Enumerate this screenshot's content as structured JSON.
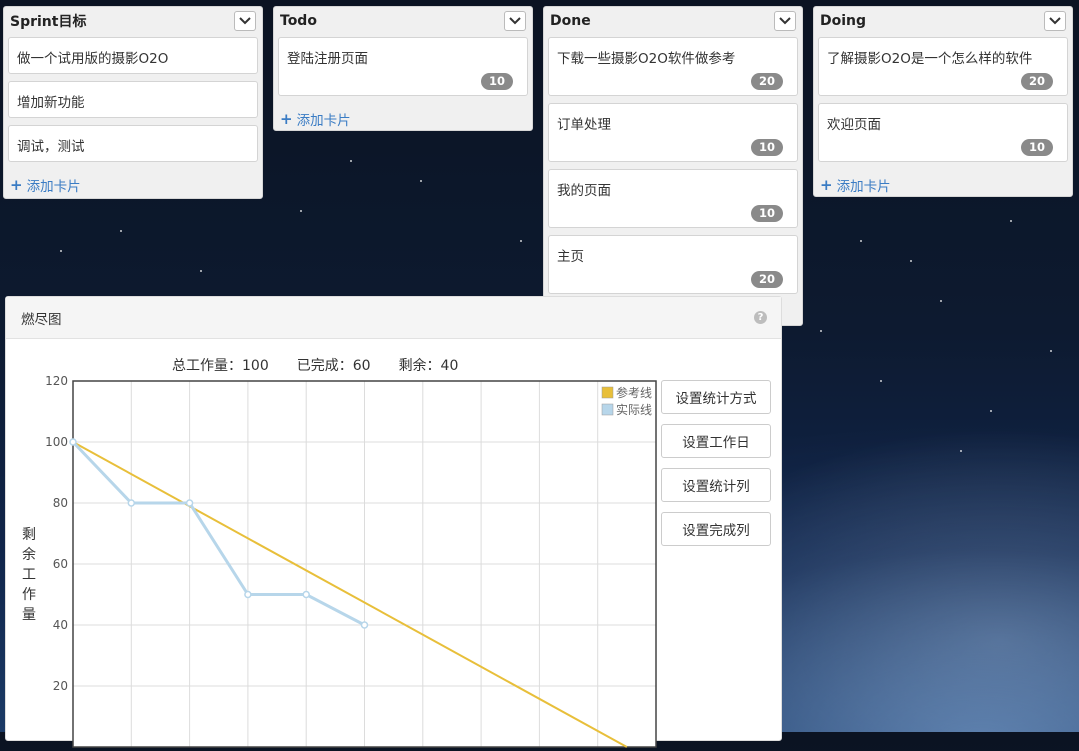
{
  "board": {
    "lists": [
      {
        "title": "Sprint目标",
        "cards": [
          {
            "text": "做一个试用版的摄影O2O"
          },
          {
            "text": "增加新功能"
          },
          {
            "text": "调试，测试"
          }
        ],
        "add_label": "添加卡片"
      },
      {
        "title": "Todo",
        "cards": [
          {
            "text": "登陆注册页面",
            "points": "10"
          }
        ],
        "add_label": "添加卡片"
      },
      {
        "title": "Done",
        "cards": [
          {
            "text": "下载一些摄影O2O软件做参考",
            "points": "20"
          },
          {
            "text": "订单处理",
            "points": "10"
          },
          {
            "text": "我的页面",
            "points": "10"
          },
          {
            "text": "主页",
            "points": "20"
          }
        ]
      },
      {
        "title": "Doing",
        "cards": [
          {
            "text": "了解摄影O2O是一个怎么样的软件",
            "points": "20"
          },
          {
            "text": "欢迎页面",
            "points": "10"
          }
        ],
        "add_label": "添加卡片"
      }
    ]
  },
  "burndown": {
    "title": "燃尽图",
    "summary": {
      "total": "总工作量：100",
      "done": "已完成：60",
      "remaining": "剩余：40"
    },
    "buttons": [
      "设置统计方式",
      "设置工作日",
      "设置统计列",
      "设置完成列"
    ],
    "ylabel": [
      "剩",
      "余",
      "工",
      "作",
      "量"
    ]
  },
  "chart_data": {
    "type": "line",
    "ylim": [
      0,
      120
    ],
    "yticks": [
      "20",
      "40",
      "60",
      "80",
      "100",
      "120"
    ],
    "x": [
      0,
      1,
      2,
      3,
      4,
      5,
      6,
      7,
      8,
      9
    ],
    "series": [
      {
        "name": "参考线",
        "color": "#e8bf3a",
        "x": [
          0,
          9.5
        ],
        "values": [
          100,
          0
        ]
      },
      {
        "name": "实际线",
        "color": "#b7d6ea",
        "x": [
          0,
          1,
          2,
          3,
          4,
          5
        ],
        "values": [
          100,
          80,
          80,
          50,
          50,
          40
        ]
      }
    ],
    "grid": true,
    "legend": "top-right"
  },
  "colors": {
    "accent_link": "#3a7cc4",
    "badge": "#8a8a8a"
  }
}
